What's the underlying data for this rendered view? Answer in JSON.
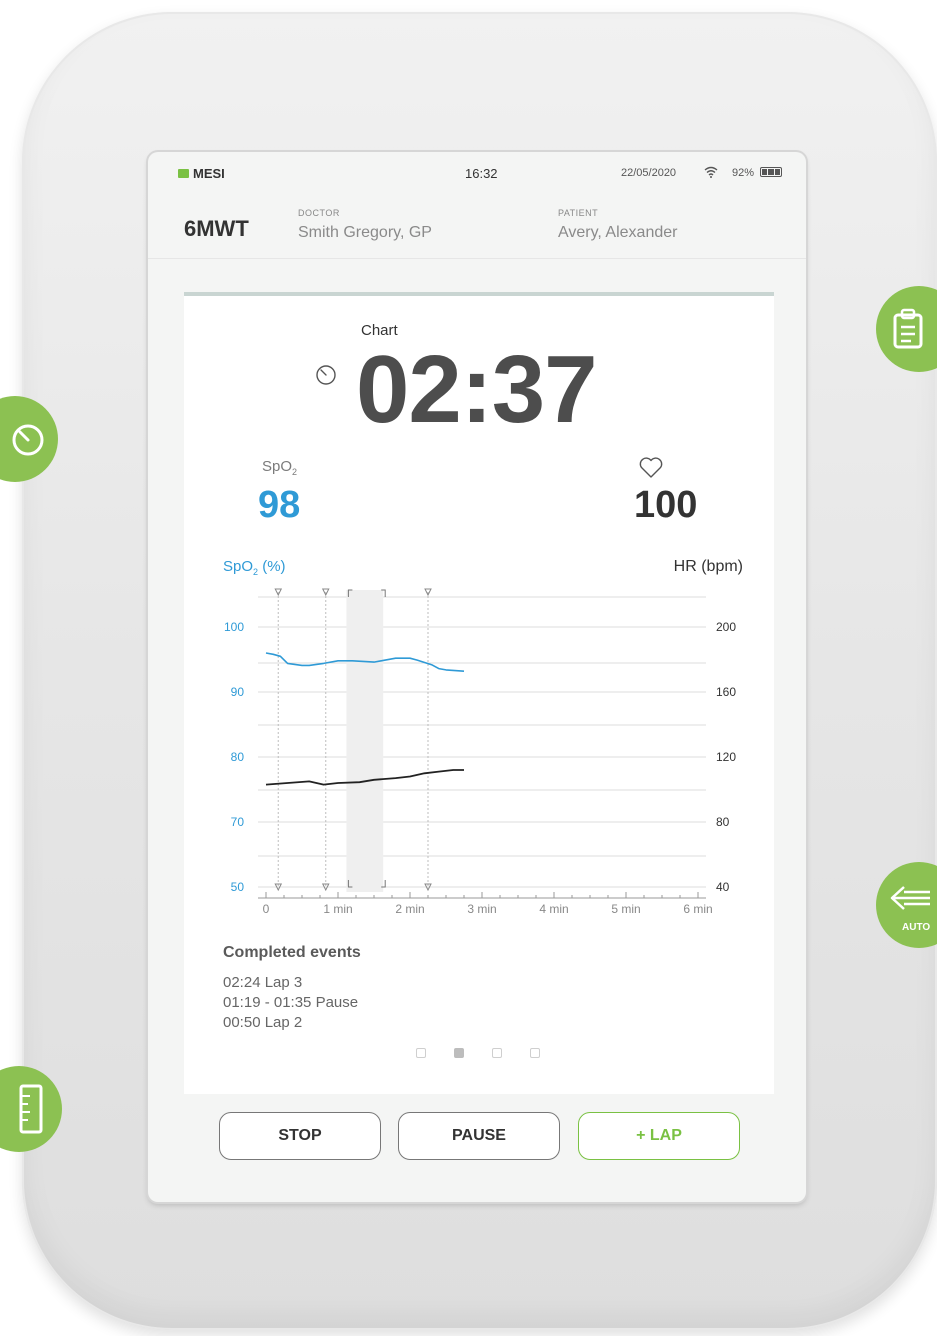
{
  "status": {
    "brand": "MESI",
    "time": "16:32",
    "date": "22/05/2020",
    "battery": "92%"
  },
  "header": {
    "test": "6MWT",
    "doctor_label": "DOCTOR",
    "doctor": "Smith Gregory, GP",
    "patient_label": "PATIENT",
    "patient": "Avery, Alexander"
  },
  "main": {
    "section_title": "Chart",
    "timer": "02:37",
    "spo2_label": "SpO",
    "spo2_sub": "2",
    "spo2_value": "98",
    "hr_value": "100"
  },
  "chart_data": {
    "type": "line",
    "left_axis_label": "SpO",
    "left_axis_label_sub": "2",
    "left_axis_label_unit": " (%)",
    "right_axis_label": "HR (bpm)",
    "left_ticks": [
      "100",
      "90",
      "80",
      "70",
      "50"
    ],
    "right_ticks": [
      "200",
      "160",
      "120",
      "80",
      "40"
    ],
    "x_ticks": [
      "0",
      "1 min",
      "2 min",
      "3 min",
      "4 min",
      "5 min",
      "6 min"
    ],
    "xlim": [
      0,
      6
    ],
    "series": [
      {
        "color": "#2f9ad6",
        "x": [
          0,
          0.1,
          0.2,
          0.3,
          0.5,
          0.6,
          0.8,
          1.0,
          1.2,
          1.5,
          1.6,
          1.8,
          2.0,
          2.1,
          2.3,
          2.4,
          2.5,
          2.75
        ],
        "y": [
          96,
          95.8,
          95.5,
          94.4,
          94.1,
          94.1,
          94.4,
          94.8,
          94.8,
          94.6,
          94.8,
          95.2,
          95.2,
          94.9,
          94.2,
          93.6,
          93.4,
          93.2
        ]
      },
      {
        "color": "#222222",
        "x": [
          0,
          0.3,
          0.6,
          0.8,
          1.0,
          1.3,
          1.5,
          1.8,
          2.0,
          2.2,
          2.4,
          2.6,
          2.75
        ],
        "y": [
          103,
          104,
          105,
          103,
          104,
          104.5,
          106,
          107,
          108,
          110,
          111,
          112,
          112
        ]
      }
    ],
    "event_markers": [
      0.17,
      0.83,
      2.25
    ],
    "pause_range": [
      1.2,
      1.6
    ]
  },
  "events": {
    "title": "Completed events",
    "items": [
      "02:24  Lap 3",
      "01:19 - 01:35  Pause",
      "00:50  Lap 2"
    ]
  },
  "buttons": {
    "stop": "STOP",
    "pause": "PAUSE",
    "lap": "+ LAP"
  },
  "side": {
    "auto_label": "AUTO"
  },
  "colors": {
    "accent": "#8cc152",
    "spo2": "#2f9ad6"
  }
}
